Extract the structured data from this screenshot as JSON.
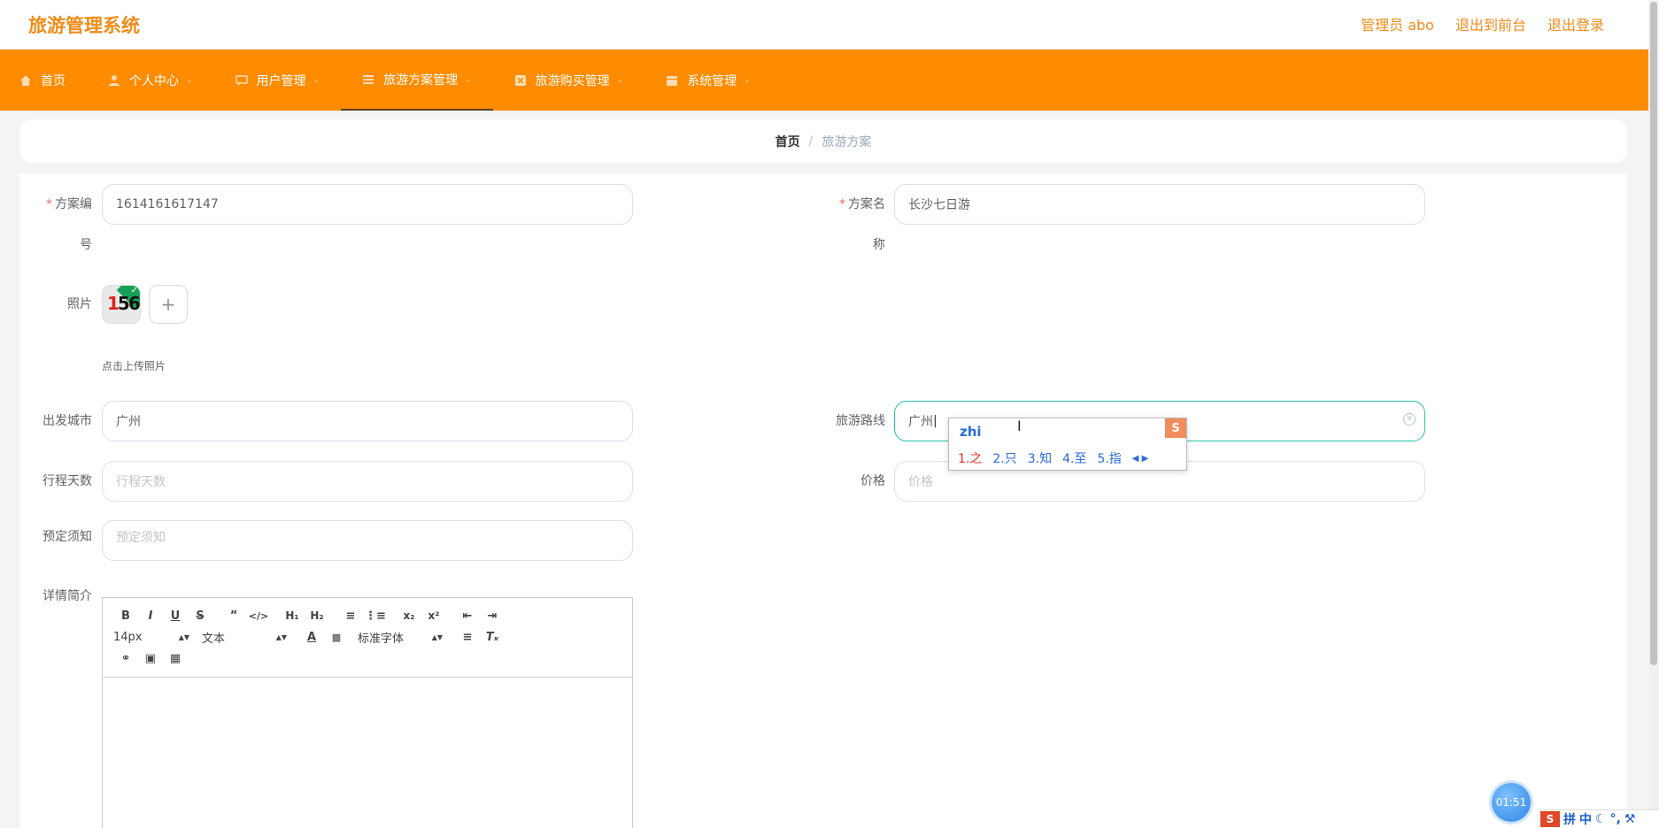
{
  "header": {
    "brand": "旅游管理系统",
    "links": [
      "管理员 abo",
      "退出到前台",
      "退出登录"
    ]
  },
  "nav": [
    {
      "label": "首页",
      "icon": "home-icon",
      "caret": false,
      "active": false
    },
    {
      "label": "个人中心",
      "icon": "user-icon",
      "caret": true,
      "active": false
    },
    {
      "label": "用户管理",
      "icon": "chat-icon",
      "caret": true,
      "active": false
    },
    {
      "label": "旅游方案管理",
      "icon": "list-icon",
      "caret": true,
      "active": true
    },
    {
      "label": "旅游购买管理",
      "icon": "box-icon",
      "caret": true,
      "active": false
    },
    {
      "label": "系统管理",
      "icon": "calendar-icon",
      "caret": true,
      "active": false
    }
  ],
  "breadcrumb": {
    "home": "首页",
    "sep": "/",
    "current": "旅游方案"
  },
  "form": {
    "plan_no": {
      "label_a": "方案编",
      "label_b": "号",
      "value": "1614161617147"
    },
    "plan_name": {
      "label_a": "方案名",
      "label_b": "称",
      "value": "长沙七日游"
    },
    "photo": {
      "label": "照片",
      "hint": "点击上传照片",
      "thumb_text_1": "1",
      "thumb_text_2": "56",
      "upload_plus": "+"
    },
    "city": {
      "label": "出发城市",
      "value": "广州"
    },
    "route": {
      "label": "旅游路线",
      "value": "广州"
    },
    "days": {
      "label": "行程天数",
      "placeholder": "行程天数"
    },
    "price": {
      "label": "价格",
      "placeholder": "价格"
    },
    "notice": {
      "label": "预定须知",
      "placeholder": "预定须知"
    },
    "detail": {
      "label": "详情简介"
    }
  },
  "editor": {
    "font_size": "14px",
    "block_type": "文本",
    "font_family": "标准字体"
  },
  "ime": {
    "composition": "zhi",
    "logo": "S",
    "candidates": [
      "1.之",
      "2.只",
      "3.知",
      "4.至",
      "5.指"
    ]
  },
  "timer": "01:51",
  "tray": [
    "拼",
    "中"
  ]
}
